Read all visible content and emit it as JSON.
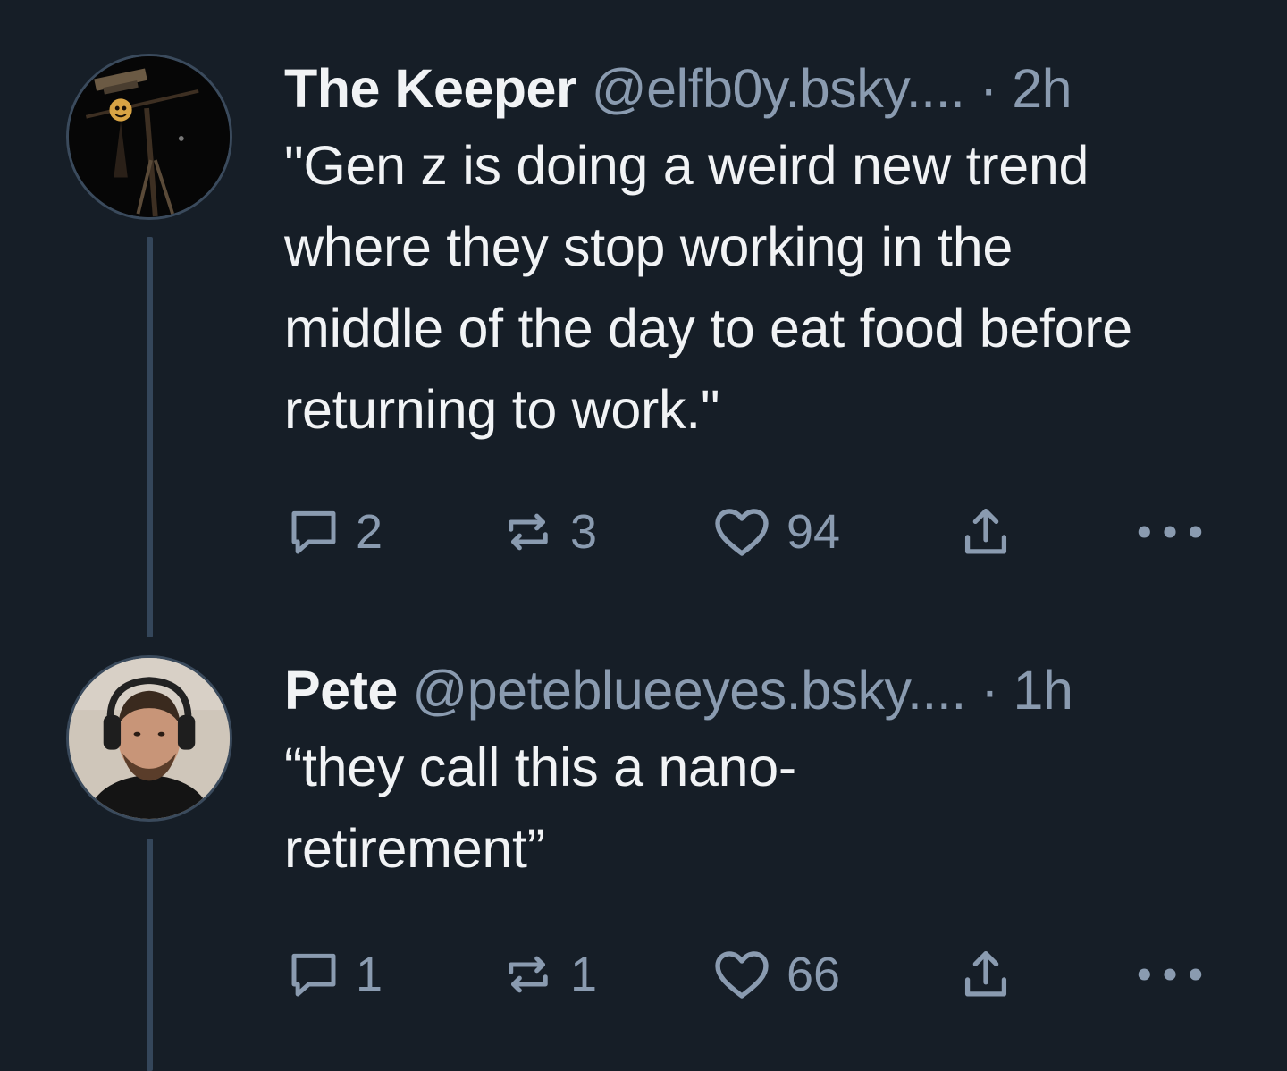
{
  "posts": [
    {
      "display_name": "The Keeper",
      "handle": "@elfb0y.bsky....",
      "separator": "·",
      "time": "2h",
      "text": "\"Gen z is doing a weird new trend where they stop working in the middle of the day to eat food before returning to work.\"",
      "replies": "2",
      "reposts": "3",
      "likes": "94"
    },
    {
      "display_name": "Pete",
      "handle": "@peteblueeyes.bsky....",
      "separator": "·",
      "time": "1h",
      "text": "“they call this a nano-retirement”",
      "replies": "1",
      "reposts": "1",
      "likes": "66"
    }
  ],
  "icons": {
    "reply": "speech-bubble-icon",
    "repost": "repost-arrows-icon",
    "like": "heart-outline-icon",
    "share": "share-upload-icon",
    "more": "ellipsis-icon"
  },
  "colors": {
    "background": "#161e27",
    "text": "#f1f3f5",
    "muted": "#8a9bb0",
    "thread_line": "#34465a"
  }
}
